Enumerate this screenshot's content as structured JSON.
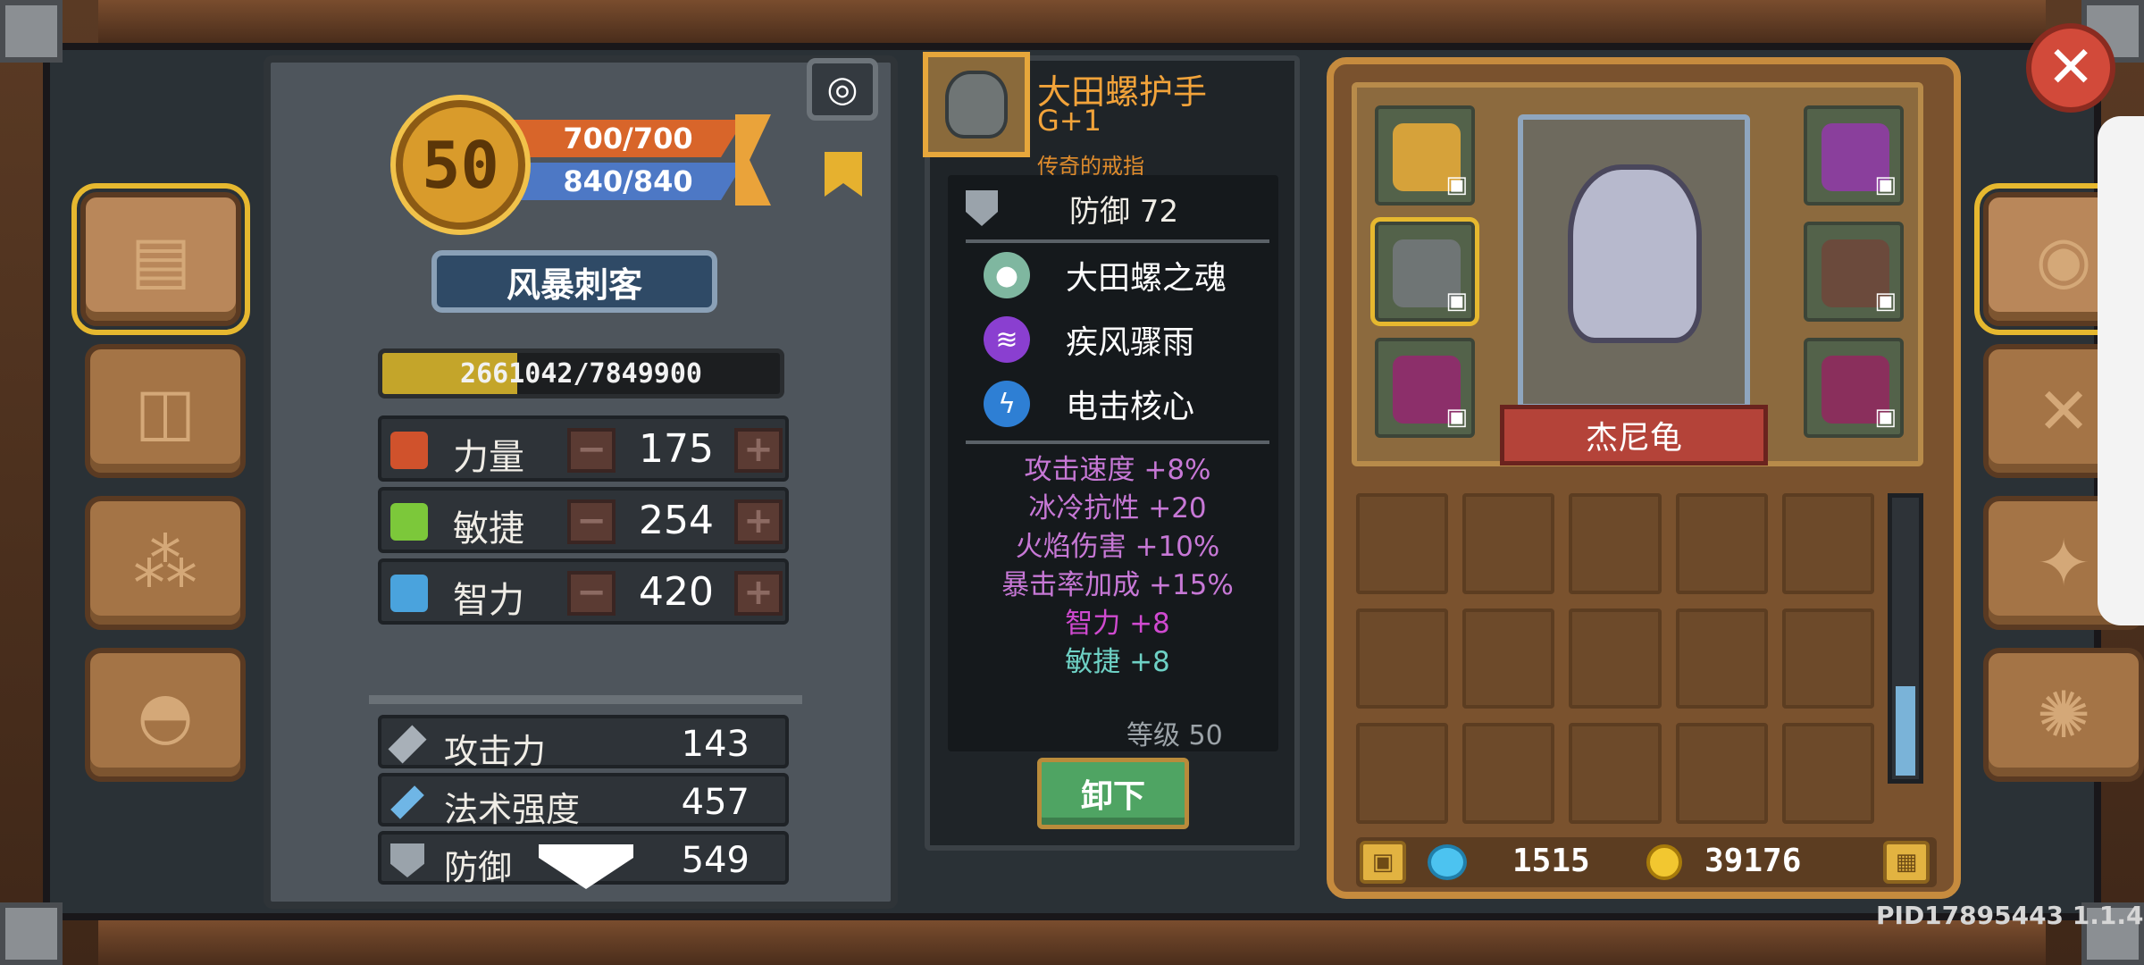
{
  "player": {
    "level": "50",
    "hp": "700/700",
    "mp": "840/840",
    "class_name": "风暴刺客",
    "xp_text": "2661042/7849900",
    "xp_fraction": 0.339
  },
  "attributes": [
    {
      "label": "力量",
      "value": "175",
      "icon_color": "#d0522c",
      "icon": "fist-icon"
    },
    {
      "label": "敏捷",
      "value": "254",
      "icon_color": "#7cc83a",
      "icon": "feather-icon"
    },
    {
      "label": "智力",
      "value": "420",
      "icon_color": "#4aa3dd",
      "icon": "book-icon"
    }
  ],
  "combat_stats": [
    {
      "label": "攻击力",
      "value": "143",
      "icon": "sword-icon"
    },
    {
      "label": "法术强度",
      "value": "457",
      "icon": "staff-icon"
    },
    {
      "label": "防御",
      "value": "549",
      "icon": "shield-icon"
    }
  ],
  "attr_buttons": {
    "minus": "−",
    "plus": "+"
  },
  "item": {
    "name": "大田螺护手",
    "grade": "G+1",
    "rarity": "传奇的戒指",
    "defense": "防御 72",
    "perks": [
      {
        "label": "大田螺之魂",
        "icon": "soul-icon",
        "color": "#7fb7a0",
        "glyph": "●"
      },
      {
        "label": "疾风骤雨",
        "icon": "tornado-icon",
        "color": "#8a3fd0",
        "glyph": "≋"
      },
      {
        "label": "电击核心",
        "icon": "lightning-icon",
        "color": "#2e7fd4",
        "glyph": "ϟ"
      }
    ],
    "bonuses": [
      {
        "text": "攻击速度 +8%",
        "color": "#c778d6"
      },
      {
        "text": "冰冷抗性 +20",
        "color": "#c778d6"
      },
      {
        "text": "火焰伤害 +10%",
        "color": "#c778d6"
      },
      {
        "text": "暴击率加成 +15%",
        "color": "#c778d6"
      },
      {
        "text": "智力 +8",
        "color": "#d04ad0"
      },
      {
        "text": "敏捷 +8",
        "color": "#6ed1c5"
      }
    ],
    "level_req": "等级 50",
    "unequip_label": "卸下"
  },
  "equipment": {
    "hero_name": "杰尼龟",
    "slots_left": [
      {
        "name": "ring-slot",
        "color": "#d6a23a"
      },
      {
        "name": "gauntlet-slot",
        "color": "#6f7575"
      },
      {
        "name": "boots-slot",
        "color": "#8c2f6a"
      }
    ],
    "slots_right": [
      {
        "name": "hat-slot",
        "color": "#8a3f9c"
      },
      {
        "name": "armor-slot",
        "color": "#6b4a3c"
      },
      {
        "name": "staff-slot",
        "color": "#8a2f5c"
      }
    ],
    "lock_glyph": "🔒"
  },
  "currency": {
    "gems": "1515",
    "gold": "39176"
  },
  "side_tabs_left": [
    "book-icon",
    "box-icon",
    "beads-icon",
    "helmet-icon"
  ],
  "side_tabs_right": [
    "mask-icon",
    "swords-icon",
    "compass-icon",
    "gear-icon"
  ],
  "footer": {
    "pid": "PID17895443 1.1.4"
  },
  "colors": {
    "accent": "#e6b82f",
    "hp": "#d8652a",
    "mp": "#4d78c5",
    "item_name": "#f2a33a"
  }
}
